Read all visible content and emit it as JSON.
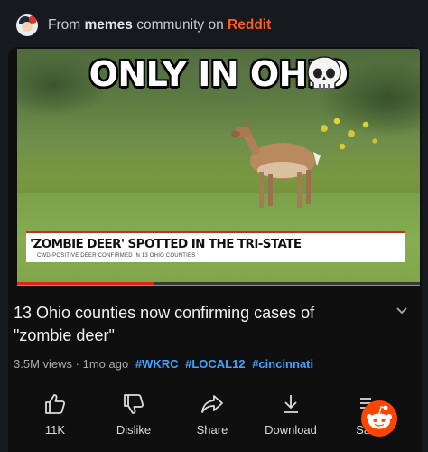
{
  "header": {
    "prefix": "From",
    "community": "memes",
    "middle": "community on",
    "brand": "Reddit"
  },
  "video": {
    "overlay_title": "ONLY IN OHIO",
    "overlay_emoji": "skull-icon",
    "chyron_headline": "'ZOMBIE DEER' SPOTTED IN THE TRI-STATE",
    "chyron_subline": "CWD-POSITIVE DEER CONFIRMED IN 13 OHIO COUNTIES",
    "progress": 0.34
  },
  "meta": {
    "title": "13 Ohio counties now confirming cases of \"zombie deer\"",
    "views": "3.5M views",
    "age": "1mo ago",
    "hashtags": [
      "#WKRC",
      "#LOCAL12",
      "#cincinnati"
    ]
  },
  "actions": {
    "like_label": "11K",
    "dislike_label": "Dislike",
    "share_label": "Share",
    "download_label": "Download",
    "save_label": "Save"
  },
  "colors": {
    "brand": "#ff4500",
    "accent_link": "#3ea6ff",
    "progress": "#e0261b",
    "chyron_red": "#c62f28"
  }
}
